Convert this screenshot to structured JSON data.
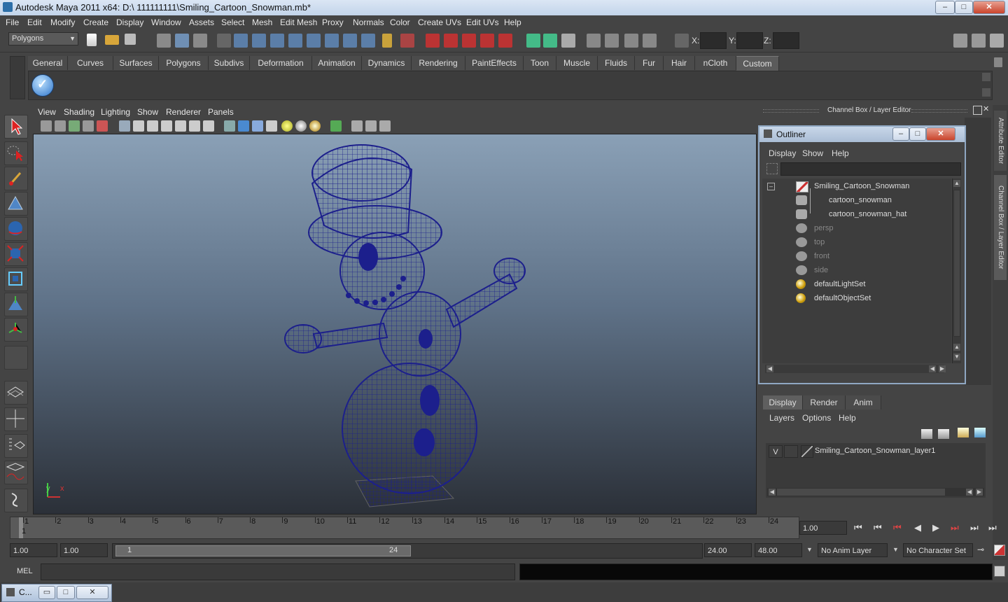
{
  "window": {
    "title": "Autodesk Maya 2011 x64: D:\\ 111111111\\Smiling_Cartoon_Snowman.mb*",
    "controls": [
      "–",
      "□",
      "✕"
    ]
  },
  "menubar": [
    "File",
    "Edit",
    "Modify",
    "Create",
    "Display",
    "Window",
    "Assets",
    "Select",
    "Mesh",
    "Edit Mesh",
    "Proxy",
    "Normals",
    "Color",
    "Create UVs",
    "Edit UVs",
    "Help"
  ],
  "statusline": {
    "menu_set": "Polygons",
    "x_label": "X:",
    "y_label": "Y:",
    "z_label": "Z:"
  },
  "shelf": {
    "tabs": [
      "General",
      "Curves",
      "Surfaces",
      "Polygons",
      "Subdivs",
      "Deformation",
      "Animation",
      "Dynamics",
      "Rendering",
      "PaintEffects",
      "Toon",
      "Muscle",
      "Fluids",
      "Fur",
      "Hair",
      "nCloth",
      "Custom"
    ],
    "active_tab": "Custom"
  },
  "viewport": {
    "menu": [
      "View",
      "Shading",
      "Lighting",
      "Show",
      "Renderer",
      "Panels"
    ],
    "axis_y": "y",
    "axis_x": "x"
  },
  "channel_box": {
    "title": "Channel Box / Layer Editor",
    "side_tabs": [
      "Attribute Editor",
      "Channel Box / Layer Editor"
    ]
  },
  "outliner": {
    "title": "Outliner",
    "menu": [
      "Display",
      "Show",
      "Help"
    ],
    "collapse_symbol": "–",
    "items": [
      {
        "label": "Smiling_Cartoon_Snowman",
        "indent": 0,
        "dim": false,
        "icon": "transform-icon"
      },
      {
        "label": "cartoon_snowman",
        "indent": 1,
        "dim": false,
        "icon": "mesh-icon"
      },
      {
        "label": "cartoon_snowman_hat",
        "indent": 1,
        "dim": false,
        "icon": "mesh-icon"
      },
      {
        "label": "persp",
        "indent": 0,
        "dim": true,
        "icon": "camera-icon"
      },
      {
        "label": "top",
        "indent": 0,
        "dim": true,
        "icon": "camera-icon"
      },
      {
        "label": "front",
        "indent": 0,
        "dim": true,
        "icon": "camera-icon"
      },
      {
        "label": "side",
        "indent": 0,
        "dim": true,
        "icon": "camera-icon"
      },
      {
        "label": "defaultLightSet",
        "indent": 0,
        "dim": false,
        "icon": "set-icon"
      },
      {
        "label": "defaultObjectSet",
        "indent": 0,
        "dim": false,
        "icon": "set-icon"
      }
    ]
  },
  "layer_editor": {
    "tabs": [
      "Display",
      "Render",
      "Anim"
    ],
    "active_tab": "Display",
    "menu": [
      "Layers",
      "Options",
      "Help"
    ],
    "layers": [
      {
        "visibility": "V",
        "name": "Smiling_Cartoon_Snowman_layer1"
      }
    ]
  },
  "time_slider": {
    "ticks": [
      "1",
      "2",
      "3",
      "4",
      "5",
      "6",
      "7",
      "8",
      "9",
      "10",
      "11",
      "12",
      "13",
      "14",
      "15",
      "16",
      "17",
      "18",
      "19",
      "20",
      "21",
      "22",
      "23",
      "24"
    ],
    "current_frame": "1",
    "current_time_field": "1.00"
  },
  "range_slider": {
    "start_time": "1.00",
    "playback_start": "1.00",
    "range_start_label": "1",
    "range_end_label": "24",
    "playback_end": "24.00",
    "end_time": "48.00",
    "anim_layer": "No Anim Layer",
    "character_set": "No Character Set"
  },
  "command_line": {
    "label": "MEL"
  },
  "taskbar": {
    "item_label": "C..."
  }
}
